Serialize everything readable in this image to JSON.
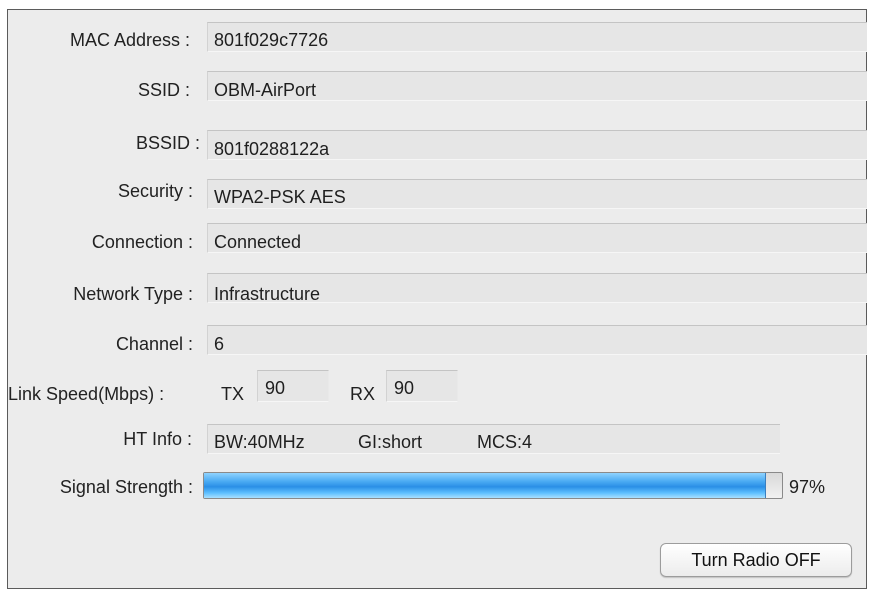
{
  "fields": {
    "mac_address": {
      "label": "MAC Address :",
      "value": "801f029c7726"
    },
    "ssid": {
      "label": "SSID :",
      "value": "OBM-AirPort"
    },
    "bssid": {
      "label": "BSSID :",
      "value": "801f0288122a"
    },
    "security": {
      "label": "Security :",
      "value": "WPA2-PSK AES"
    },
    "connection": {
      "label": "Connection :",
      "value": "Connected"
    },
    "network_type": {
      "label": "Network Type :",
      "value": "Infrastructure"
    },
    "channel": {
      "label": "Channel :",
      "value": "6"
    }
  },
  "link_speed": {
    "label": "Link Speed(Mbps) :",
    "tx_label": "TX",
    "tx_value": "90",
    "rx_label": "RX",
    "rx_value": "90"
  },
  "ht_info": {
    "label": "HT Info :",
    "bw": "BW:40MHz",
    "gi": "GI:short",
    "mcs": "MCS:4"
  },
  "signal_strength": {
    "label": "Signal Strength :",
    "percent_text": "97%",
    "level": 0.97,
    "fill_color": "#2a8fe6"
  },
  "buttons": {
    "turn_radio_off": "Turn Radio OFF"
  }
}
